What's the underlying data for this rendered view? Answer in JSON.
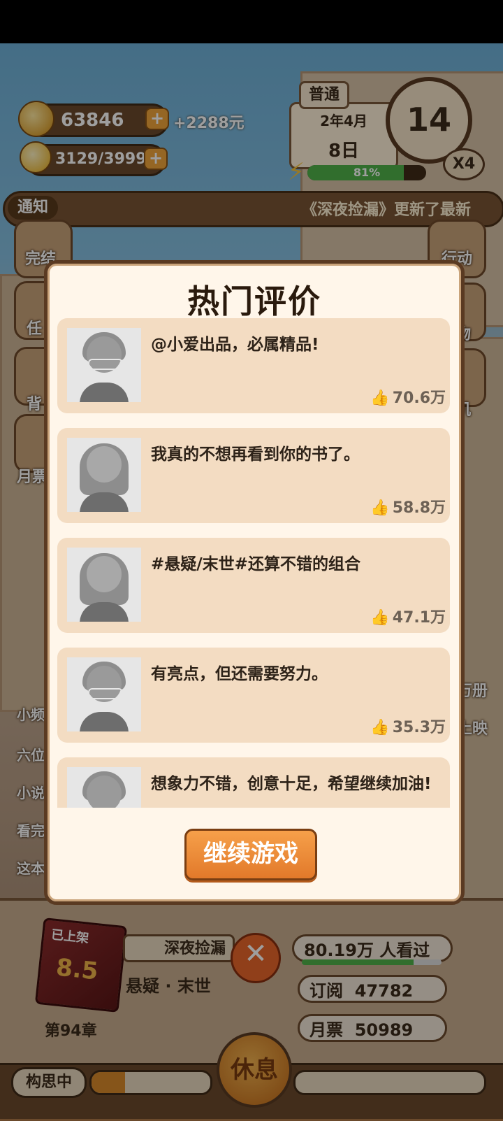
{
  "hud": {
    "coins": "63846",
    "income": "+2288元",
    "inspiration": "3129/3999",
    "difficulty": "普通",
    "date_year_month": "2年4月",
    "date_day": "8日",
    "energy_percent": "81%",
    "energy_fraction": 0.81,
    "day_counter": "14",
    "speed": "X4"
  },
  "notice": {
    "tag": "通知",
    "text": "《深夜捡漏》更新了最新"
  },
  "side_left": [
    "完结",
    "任",
    "背",
    "月票"
  ],
  "side_right": [
    "行动",
    "物",
    "机"
  ],
  "side_right_mid": [
    "万册",
    "上映"
  ],
  "side_left_small": [
    "小频",
    "六位",
    "小说",
    "看完",
    "这本"
  ],
  "modal": {
    "title": "热门评价",
    "continue_label": "继续游戏",
    "reviews": [
      {
        "text": "@小爱出品，必属精品!",
        "likes": "70.6万",
        "avatar": "glasses"
      },
      {
        "text": "我真的不想再看到你的书了。",
        "likes": "58.8万",
        "avatar": "longhair"
      },
      {
        "text": "#悬疑/末世#还算不错的组合",
        "likes": "47.1万",
        "avatar": "longhair"
      },
      {
        "text": "有亮点，但还需要努力。",
        "likes": "35.3万",
        "avatar": "glasses"
      },
      {
        "text": "想象力不错，创意十足，希望继续加油!",
        "likes": "",
        "avatar": "glasses"
      }
    ]
  },
  "book": {
    "status": "已上架",
    "score": "8.5",
    "title": "深夜捡漏",
    "genre": "悬疑 · 末世",
    "chapter": "第94章",
    "views": "80.19万 人看过",
    "subscriptions_label": "订阅",
    "subscriptions": "47782",
    "monthly_label": "月票",
    "monthly": "50989"
  },
  "bottom": {
    "status": "构思中",
    "rest": "休息"
  }
}
